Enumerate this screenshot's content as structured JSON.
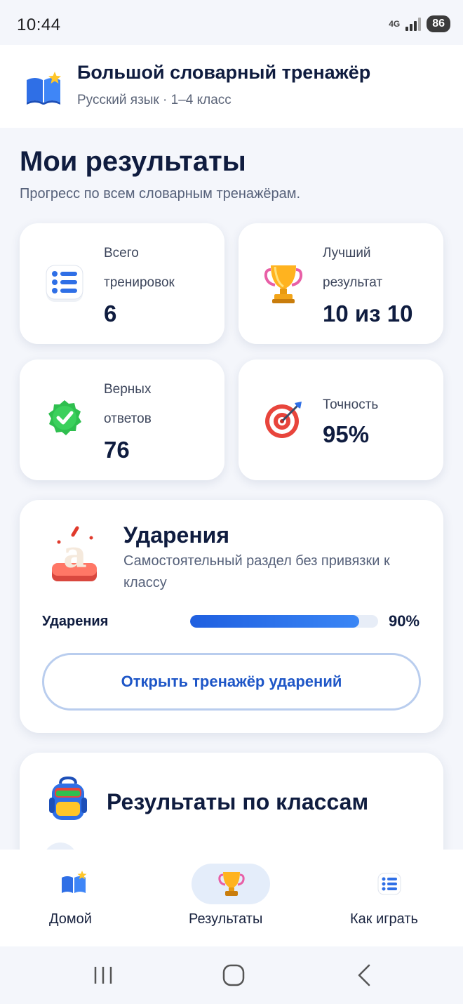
{
  "status_bar": {
    "time": "10:44",
    "network": "4G",
    "battery": "86"
  },
  "header": {
    "title": "Большой словарный тренажёр",
    "subtitle": "Русский язык · 1–4 класс",
    "icon": "open-book-star-icon"
  },
  "page": {
    "title": "Мои результаты",
    "subtitle": "Прогресс по всем словарным тренажёрам."
  },
  "stats": [
    {
      "icon": "list-icon",
      "label_line1": "Всего",
      "label_line2": "тренировок",
      "value": "6"
    },
    {
      "icon": "trophy-icon",
      "label_line1": "Лучший",
      "label_line2": "результат",
      "value": "10 из 10"
    },
    {
      "icon": "check-badge-icon",
      "label_line1": "Верных",
      "label_line2": "ответов",
      "value": "76"
    },
    {
      "icon": "target-icon",
      "label_line1": "Точность",
      "label_line2": "",
      "value": "95%"
    }
  ],
  "stress_card": {
    "icon": "accent-letter-a-icon",
    "title": "Ударения",
    "description": "Самостоятельный раздел без привязки к классу",
    "progress_label": "Ударения",
    "progress_percent": 90,
    "progress_text": "90%",
    "button_label": "Открыть тренажёр ударений"
  },
  "classes_card": {
    "icon": "backpack-icon",
    "title": "Результаты по классам"
  },
  "bottom_nav": [
    {
      "icon": "open-book-star-icon",
      "label": "Домой",
      "active": false
    },
    {
      "icon": "trophy-icon",
      "label": "Результаты",
      "active": true
    },
    {
      "icon": "list-icon",
      "label": "Как играть",
      "active": false
    }
  ],
  "colors": {
    "accent": "#1e56c7",
    "progress": "#2a6ff0",
    "background": "#f4f6fb",
    "text_dark": "#0f1c3f"
  }
}
